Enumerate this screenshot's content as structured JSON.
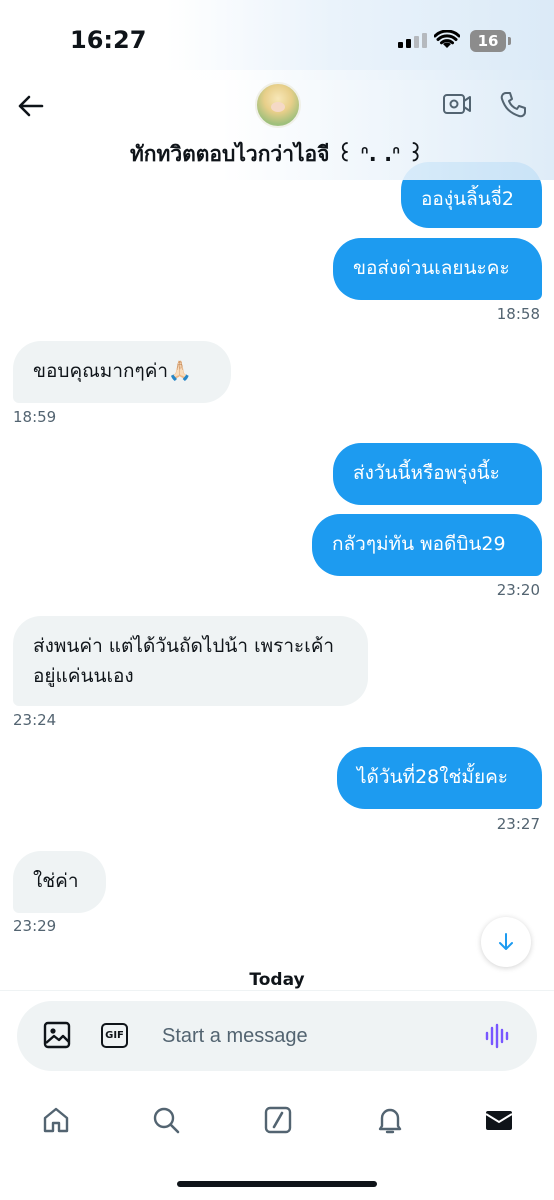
{
  "status_bar": {
    "time": "16:27",
    "battery": "16"
  },
  "header": {
    "chat_name": "ทักทวิตตอบไวกว่าไอจี ꒰ ᐢ. .ᐢ ꒱"
  },
  "messages": [
    {
      "dir": "out",
      "text": "อองุ่นลิ้นจี่2"
    },
    {
      "dir": "out",
      "text": "ขอส่งด่วนเลยนะคะ"
    },
    {
      "dir": "out",
      "time": "18:58"
    },
    {
      "dir": "in",
      "text": "ขอบคุณมากๆค่า🙏🏻"
    },
    {
      "dir": "in",
      "time": "18:59"
    },
    {
      "dir": "out",
      "text": "ส่งวันนี้หรือพรุ่งนี้ะ"
    },
    {
      "dir": "out",
      "text": "กลัวๆม่ทัน พอดีบิน29"
    },
    {
      "dir": "out",
      "time": "23:20"
    },
    {
      "dir": "in",
      "text": "ส่งพนค่า แต่ได้วันถัดไปน้า เพราะเค้าอยู่แค่นนเอง"
    },
    {
      "dir": "in",
      "time": "23:24"
    },
    {
      "dir": "out",
      "text": "ได้วันที่28ใช่มั้ยคะ"
    },
    {
      "dir": "out",
      "time": "23:27"
    },
    {
      "dir": "in",
      "text": "ใช่ค่า"
    },
    {
      "dir": "in",
      "time": "23:29"
    }
  ],
  "divider": {
    "today_label": "Today"
  },
  "composer": {
    "placeholder": "Start a message",
    "gif_label": "GIF"
  },
  "nav": {
    "items": [
      "home-icon",
      "search-icon",
      "grok-icon",
      "notifications-icon",
      "messages-icon"
    ]
  },
  "colors": {
    "accent": "#1d9bf0",
    "incoming_bg": "#eff3f4",
    "voice": "#7856ff"
  }
}
